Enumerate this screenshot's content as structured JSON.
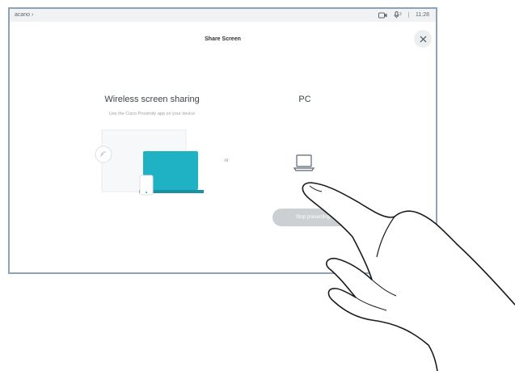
{
  "status_bar": {
    "left_text": "acano ›",
    "time": "11:28",
    "icons": [
      "camera-icon",
      "microphone-icon"
    ]
  },
  "dialog": {
    "title": "Share Screen",
    "close_icon": "close-icon"
  },
  "wireless": {
    "heading": "Wireless screen sharing",
    "subtitle": "Use the Cisco Proximity app on your device"
  },
  "separator_text": "or",
  "pc": {
    "heading": "PC",
    "icon": "laptop-icon"
  },
  "stop_button_label": "Stop presenting",
  "colors": {
    "accent": "#1fb2c4",
    "frame": "#8fa3b8",
    "button": "#cdd0d3"
  }
}
